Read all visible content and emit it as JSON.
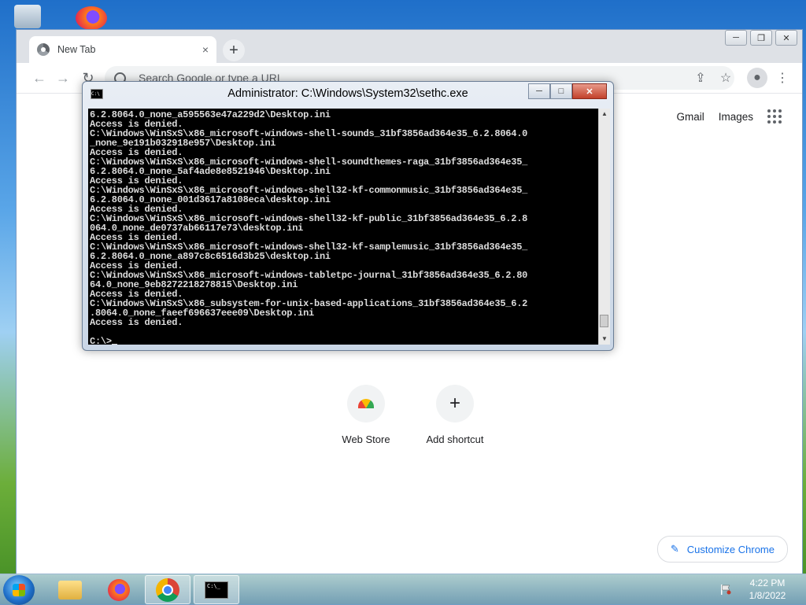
{
  "chrome": {
    "tab_title": "New Tab",
    "tab_close": "×",
    "newtab": "+",
    "win_min": "─",
    "win_max": "❐",
    "win_close": "✕",
    "omnibox_placeholder": "Search Google or type a URL",
    "gmail": "Gmail",
    "images": "Images",
    "shortcuts": [
      {
        "label": "Web Store"
      },
      {
        "label": "Add shortcut",
        "icon": "+"
      }
    ],
    "customize": "Customize Chrome"
  },
  "cmd": {
    "title": "Administrator: C:\\Windows\\System32\\sethc.exe",
    "sysicon": "C:\\",
    "min": "─",
    "max": "□",
    "close": "✕",
    "lines": [
      "6.2.8064.0_none_a595563e47a229d2\\Desktop.ini",
      "Access is denied.",
      "C:\\Windows\\WinSxS\\x86_microsoft-windows-shell-sounds_31bf3856ad364e35_6.2.8064.0",
      "_none_9e191b032918e957\\Desktop.ini",
      "Access is denied.",
      "C:\\Windows\\WinSxS\\x86_microsoft-windows-shell-soundthemes-raga_31bf3856ad364e35_",
      "6.2.8064.0_none_5af4ade8e8521946\\Desktop.ini",
      "Access is denied.",
      "C:\\Windows\\WinSxS\\x86_microsoft-windows-shell32-kf-commonmusic_31bf3856ad364e35_",
      "6.2.8064.0_none_001d3617a8108eca\\desktop.ini",
      "Access is denied.",
      "C:\\Windows\\WinSxS\\x86_microsoft-windows-shell32-kf-public_31bf3856ad364e35_6.2.8",
      "064.0_none_de0737ab66117e73\\desktop.ini",
      "Access is denied.",
      "C:\\Windows\\WinSxS\\x86_microsoft-windows-shell32-kf-samplemusic_31bf3856ad364e35_",
      "6.2.8064.0_none_a897c8c6516d3b25\\desktop.ini",
      "Access is denied.",
      "C:\\Windows\\WinSxS\\x86_microsoft-windows-tabletpc-journal_31bf3856ad364e35_6.2.80",
      "64.0_none_9eb8272218278815\\Desktop.ini",
      "Access is denied.",
      "C:\\Windows\\WinSxS\\x86_subsystem-for-unix-based-applications_31bf3856ad364e35_6.2",
      ".8064.0_none_faeef696637eee09\\Desktop.ini",
      "Access is denied.",
      "",
      "C:\\>"
    ]
  },
  "taskbar": {
    "time": "4:22 PM",
    "date": "1/8/2022",
    "cmd_icon_text": "C:\\_"
  }
}
